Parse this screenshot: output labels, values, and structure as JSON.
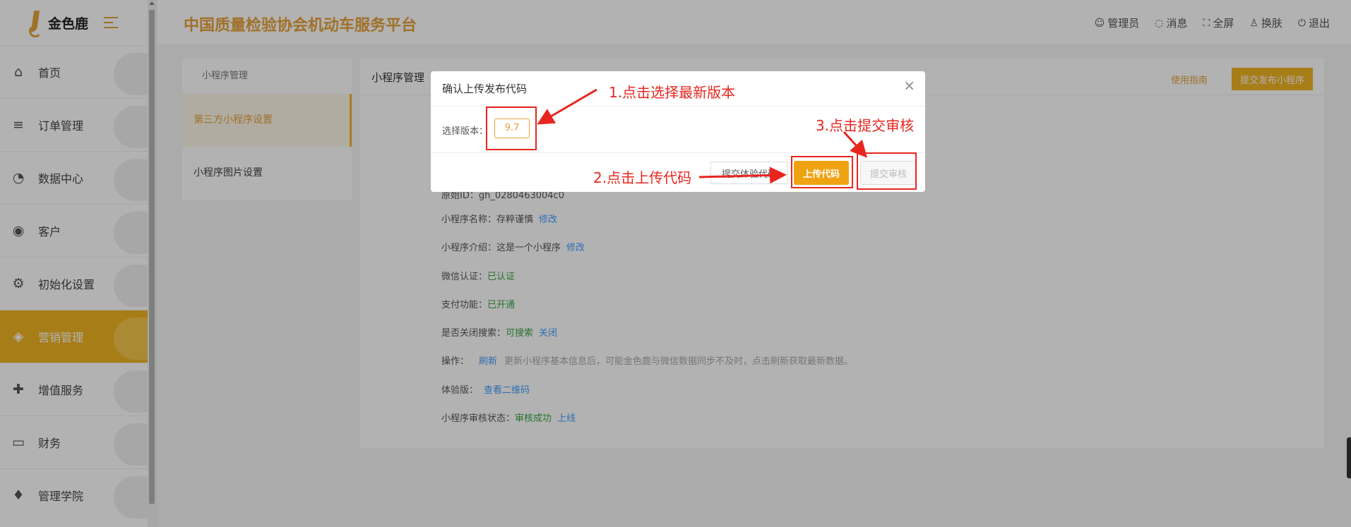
{
  "sidebar": {
    "logo_text": "金色鹿",
    "items": [
      {
        "label": "首页",
        "icon": "home-icon",
        "glyph": "⌂"
      },
      {
        "label": "订单管理",
        "icon": "list-icon",
        "glyph": "≡"
      },
      {
        "label": "数据中心",
        "icon": "chart-icon",
        "glyph": "◔"
      },
      {
        "label": "客户",
        "icon": "user-icon",
        "glyph": "◉"
      },
      {
        "label": "初始化设置",
        "icon": "gear-icon",
        "glyph": "⚙"
      },
      {
        "label": "营销管理",
        "icon": "tag-icon",
        "glyph": "◈"
      },
      {
        "label": "增值服务",
        "icon": "add-user-icon",
        "glyph": "✚"
      },
      {
        "label": "财务",
        "icon": "card-icon",
        "glyph": "▭"
      },
      {
        "label": "管理学院",
        "icon": "graduation-cap-icon",
        "glyph": "♦"
      }
    ]
  },
  "header": {
    "title": "中国质量检验协会机动车服务平台",
    "actions": [
      "管理员",
      "消息",
      "全屏",
      "换肤",
      "退出"
    ]
  },
  "submenu": {
    "title": "小程序管理",
    "items": [
      "第三方小程序设置",
      "小程序图片设置"
    ]
  },
  "panel": {
    "title": "小程序管理",
    "guide_link": "使用指南",
    "publish_button": "提交发布小程序",
    "partial_row": "原始ID：gh_0280463004c0",
    "rows": {
      "name_label": "小程序名称：",
      "name_value": "存粹谨慎",
      "name_link": "修改",
      "intro_label": "小程序介绍：",
      "intro_value": "这是一个小程序",
      "intro_link": "修改",
      "verify_label": "微信认证：",
      "verify_value": "已认证",
      "pay_label": "支付功能：",
      "pay_value": "已开通",
      "search_label": "是否关闭搜索：",
      "search_value": "可搜索",
      "search_link": "关闭",
      "op_label": "操作：",
      "op_link": "刷新",
      "op_hint": "更新小程序基本信息后，可能金色鹿与微信数据同步不及时，点击刷新获取最新数据。",
      "exp_label": "体验版：",
      "exp_link": "查看二维码",
      "audit_label": "小程序审核状态：",
      "audit_value": "审核成功",
      "audit_link": "上线"
    }
  },
  "dialog": {
    "title": "确认上传发布代码",
    "version_label": "选择版本：",
    "version_value": "9.7",
    "experience_button": "提交体验代码",
    "upload_button": "上传代码",
    "review_button": "提交审核"
  },
  "annotations": {
    "step1": "1.点击选择最新版本",
    "step2": "2.点击上传代码",
    "step3": "3.点击提交审核"
  },
  "colors": {
    "accent": "#f0b323",
    "title_orange": "#e6a23c",
    "annotation_red": "#e8261f",
    "success_green": "#3aa544",
    "link_blue": "#409eff"
  }
}
